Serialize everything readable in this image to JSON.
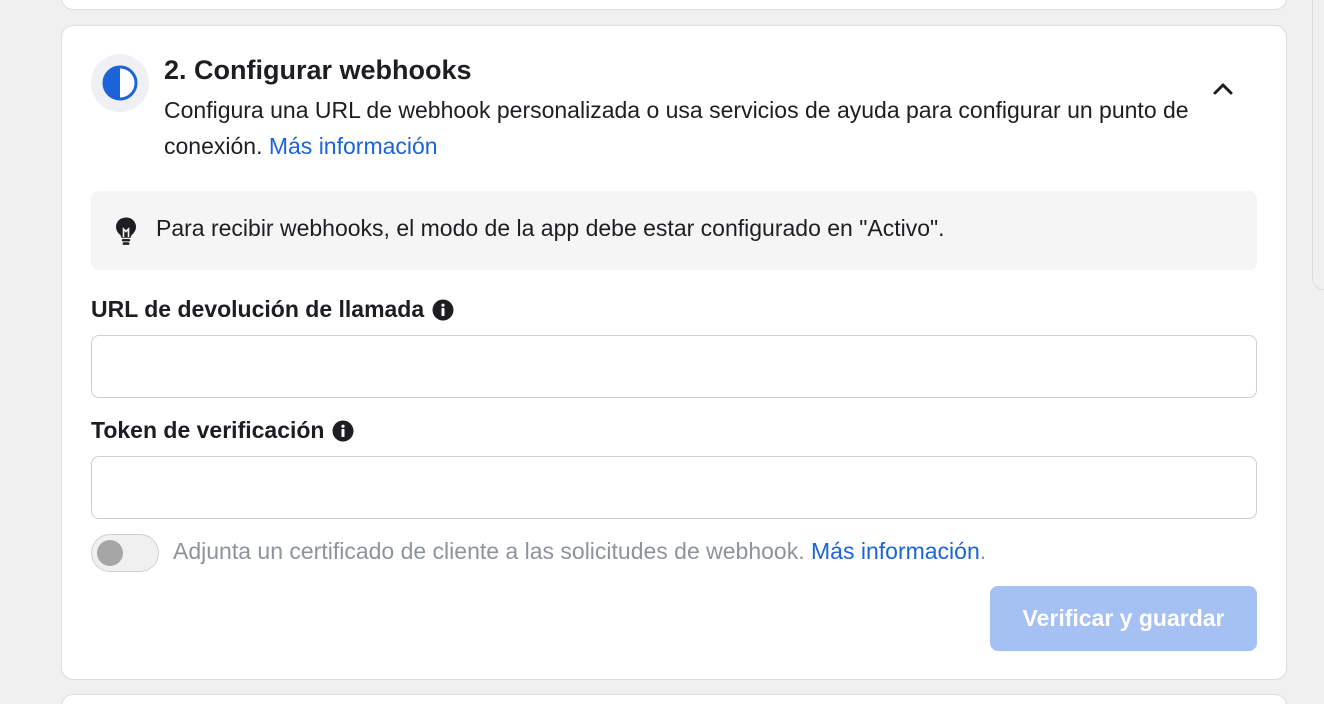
{
  "step": {
    "title": "2. Configurar webhooks",
    "description": "Configura una URL de webhook personalizada o usa servicios de ayuda para configurar un punto de conexión.",
    "learn_more": "Más información",
    "icon": "half-circle-progress-icon",
    "collapse_icon": "chevron-up-icon"
  },
  "notice": {
    "icon": "lightbulb-icon",
    "text": "Para recibir webhooks, el modo de la app debe estar configurado en \"Activo\"."
  },
  "fields": {
    "callback_url": {
      "label": "URL de devolución de llamada",
      "value": "",
      "info_icon": "info-icon"
    },
    "verify_token": {
      "label": "Token de verificación",
      "value": "",
      "info_icon": "info-icon"
    }
  },
  "client_certificate": {
    "enabled": false,
    "text": "Adjunta un certificado de cliente a las solicitudes de webhook.",
    "learn_more": "Más información",
    "trailing": "."
  },
  "actions": {
    "save_label": "Verificar y guardar",
    "save_enabled": false
  },
  "colors": {
    "accent": "#1b64d8",
    "disabled_button": "#a5c0f3"
  }
}
